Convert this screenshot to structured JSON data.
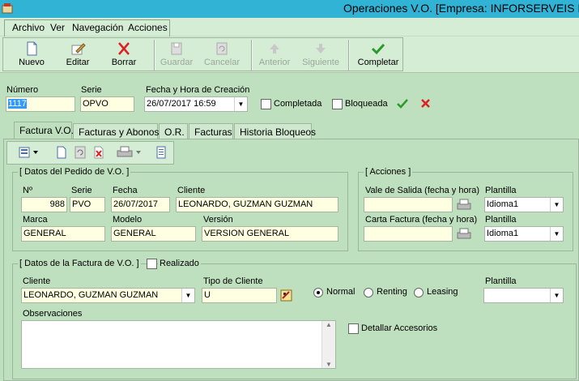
{
  "window": {
    "title": "Operaciones V.O. [Empresa: INFORSERVEIS N"
  },
  "menu": {
    "items": [
      "Archivo",
      "Ver",
      "Navegación",
      "Acciones"
    ]
  },
  "toolbar": {
    "nuevo": "Nuevo",
    "editar": "Editar",
    "borrar": "Borrar",
    "guardar": "Guardar",
    "cancelar": "Cancelar",
    "anterior": "Anterior",
    "siguiente": "Siguiente",
    "completar": "Completar"
  },
  "header": {
    "numero_label": "Número",
    "numero_value": "1117",
    "serie_label": "Serie",
    "serie_value": "OPVO",
    "fecha_label": "Fecha y Hora de Creación",
    "fecha_value": "26/07/2017 16:59",
    "completada_label": "Completada",
    "bloqueada_label": "Bloqueada"
  },
  "tabs": [
    "Factura V.O.",
    "Facturas y Abonos",
    "O.R.",
    "Facturas",
    "Historia Bloqueos"
  ],
  "pedido": {
    "title": "[ Datos del Pedido de V.O. ]",
    "n_label": "Nº",
    "n_value": "988",
    "serie_label": "Serie",
    "serie_value": "PVO",
    "fecha_label": "Fecha",
    "fecha_value": "26/07/2017",
    "cliente_label": "Cliente",
    "cliente_value": "LEONARDO, GUZMAN GUZMAN",
    "marca_label": "Marca",
    "marca_value": "GENERAL",
    "modelo_label": "Modelo",
    "modelo_value": "GENERAL",
    "version_label": "Versión",
    "version_value": "VERSION GENERAL"
  },
  "acciones": {
    "title": "[ Acciones ]",
    "vale_label": "Vale de Salida (fecha y hora)",
    "plantilla1_label": "Plantilla",
    "plantilla1_value": "Idioma1",
    "carta_label": "Carta Factura (fecha y hora)",
    "plantilla2_label": "Plantilla",
    "plantilla2_value": "Idioma1"
  },
  "factura": {
    "title": "[ Datos de la Factura de V.O. ]",
    "realizado_label": "Realizado",
    "cliente_label": "Cliente",
    "cliente_value": "LEONARDO, GUZMAN GUZMAN",
    "tipo_label": "Tipo de Cliente",
    "tipo_value": "U",
    "normal_label": "Normal",
    "renting_label": "Renting",
    "leasing_label": "Leasing",
    "plantilla_label": "Plantilla",
    "observaciones_label": "Observaciones",
    "detallar_label": "Detallar Accesorios"
  }
}
